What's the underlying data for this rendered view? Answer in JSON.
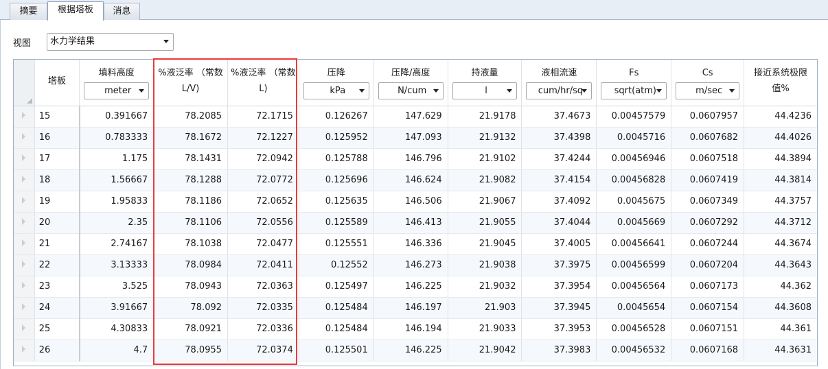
{
  "tabs": [
    {
      "label": "摘要",
      "active": false
    },
    {
      "label": "根据塔板",
      "active": true
    },
    {
      "label": "消息",
      "active": false
    }
  ],
  "view": {
    "label": "视图",
    "selected": "水力学结果"
  },
  "table": {
    "stage_header": "塔板",
    "columns": [
      {
        "label": "填料高度",
        "unit": "meter"
      },
      {
        "label": "%液泛率 （常数L/V)",
        "unit": ""
      },
      {
        "label": "%液泛率 （常数L)",
        "unit": ""
      },
      {
        "label": "压降",
        "unit": "kPa"
      },
      {
        "label": "压降/高度",
        "unit": "N/cum"
      },
      {
        "label": "持液量",
        "unit": "l"
      },
      {
        "label": "液相流速",
        "unit": "cum/hr/sq"
      },
      {
        "label": "Fs",
        "unit": "sqrt(atm)"
      },
      {
        "label": "Cs",
        "unit": "m/sec"
      },
      {
        "label": "接近系统极限值%",
        "unit": ""
      }
    ],
    "rows": [
      [
        "15",
        "0.391667",
        "78.2085",
        "72.1715",
        "0.126267",
        "147.629",
        "21.9178",
        "37.4673",
        "0.00457579",
        "0.0607957",
        "44.4236"
      ],
      [
        "16",
        "0.783333",
        "78.1672",
        "72.1227",
        "0.125952",
        "147.093",
        "21.9132",
        "37.4398",
        "0.0045716",
        "0.0607682",
        "44.4026"
      ],
      [
        "17",
        "1.175",
        "78.1431",
        "72.0942",
        "0.125788",
        "146.796",
        "21.9102",
        "37.4244",
        "0.00456946",
        "0.0607518",
        "44.3894"
      ],
      [
        "18",
        "1.56667",
        "78.1288",
        "72.0772",
        "0.125696",
        "146.624",
        "21.9082",
        "37.4154",
        "0.00456828",
        "0.0607419",
        "44.3814"
      ],
      [
        "19",
        "1.95833",
        "78.1186",
        "72.0652",
        "0.125635",
        "146.506",
        "21.9067",
        "37.4092",
        "0.0045675",
        "0.0607349",
        "44.3757"
      ],
      [
        "20",
        "2.35",
        "78.1106",
        "72.0556",
        "0.125589",
        "146.413",
        "21.9055",
        "37.4044",
        "0.0045669",
        "0.0607292",
        "44.3712"
      ],
      [
        "21",
        "2.74167",
        "78.1038",
        "72.0477",
        "0.125551",
        "146.336",
        "21.9045",
        "37.4005",
        "0.00456641",
        "0.0607244",
        "44.3674"
      ],
      [
        "22",
        "3.13333",
        "78.0984",
        "72.0411",
        "0.12552",
        "146.273",
        "21.9038",
        "37.3975",
        "0.00456599",
        "0.0607204",
        "44.3643"
      ],
      [
        "23",
        "3.525",
        "78.0943",
        "72.0363",
        "0.125497",
        "146.225",
        "21.9032",
        "37.3954",
        "0.00456564",
        "0.0607173",
        "44.362"
      ],
      [
        "24",
        "3.91667",
        "78.092",
        "72.0335",
        "0.125484",
        "146.197",
        "21.903",
        "37.3945",
        "0.0045654",
        "0.0607154",
        "44.3608"
      ],
      [
        "25",
        "4.30833",
        "78.0921",
        "72.0336",
        "0.125484",
        "146.194",
        "21.9033",
        "37.3953",
        "0.00456528",
        "0.0607151",
        "44.361"
      ],
      [
        "26",
        "4.7",
        "78.0955",
        "72.0374",
        "0.125501",
        "146.225",
        "21.9042",
        "37.3983",
        "0.00456532",
        "0.0607168",
        "44.3631"
      ]
    ]
  },
  "colors": {
    "highlight_border": "#e83b3b",
    "grid_border": "#9fb0c3"
  }
}
